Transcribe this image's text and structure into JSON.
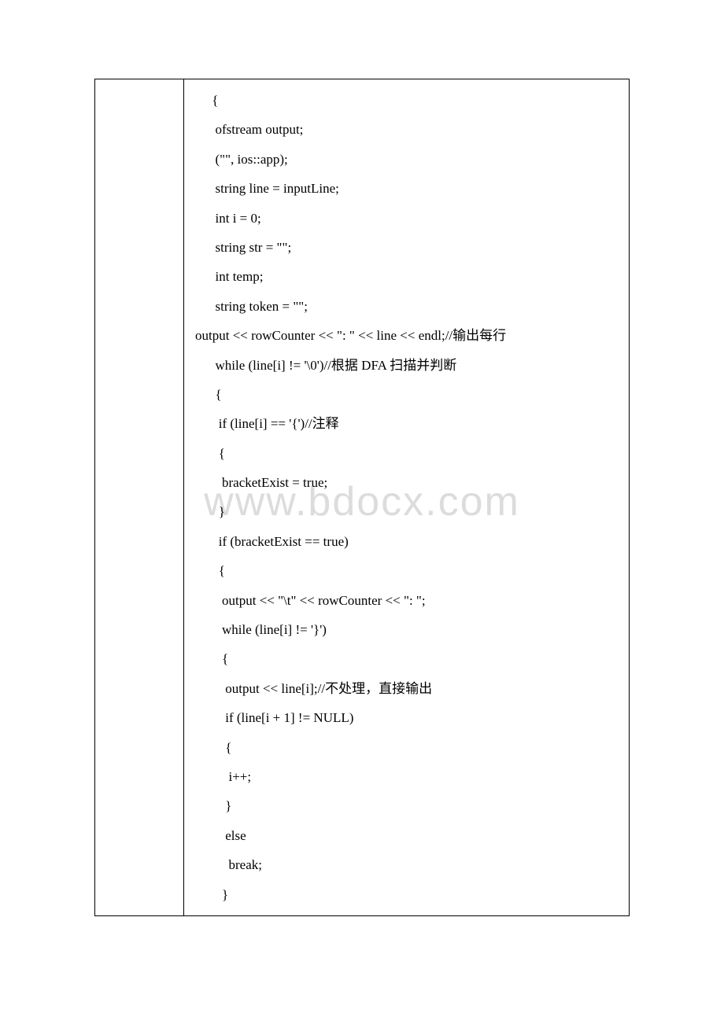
{
  "watermark": "www.bdocx.com",
  "code_lines": [
    "     {",
    "      ofstream output;",
    "      (\"\", ios::app);",
    "      string line = inputLine;",
    "      int i = 0;",
    "      string str = \"\";",
    "      int temp;",
    "      string token = \"\";",
    "      output << rowCounter << \": \" << line << endl;//输出每行",
    "      while (line[i] != '\\0')//根据 DFA 扫描并判断",
    "      {",
    "       if (line[i] == '{')//注释",
    "       {",
    "        bracketExist = true;",
    "       }",
    "       if (bracketExist == true)",
    "       {",
    "        output << \"\\t\" << rowCounter << \": \";",
    "        while (line[i] != '}')",
    "        {",
    "         output << line[i];//不处理，直接输出",
    "         if (line[i + 1] != NULL)",
    "         {",
    "          i++;",
    "         }",
    "         else",
    "          break;",
    "        }"
  ]
}
